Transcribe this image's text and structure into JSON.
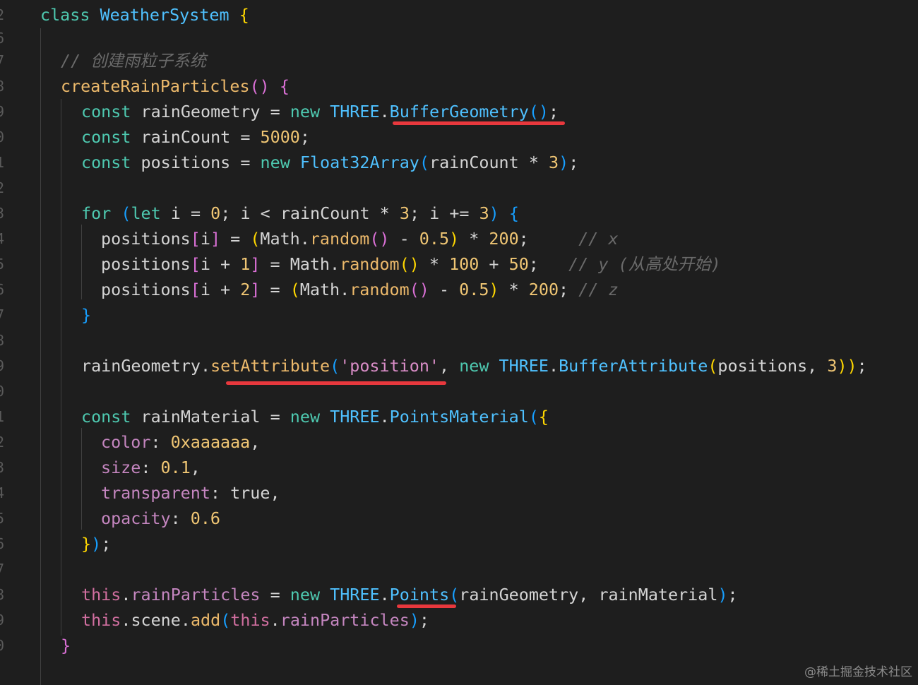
{
  "editor": {
    "line_numbers": [
      "2",
      "6",
      "7",
      "8",
      "9",
      "0",
      "1",
      "2",
      "3",
      "4",
      "5",
      "6",
      "7",
      "8",
      "9",
      "0",
      "1",
      "2",
      "3",
      "4",
      "5",
      "6",
      "7",
      "8",
      "9",
      "0"
    ],
    "code": {
      "l1": {
        "a": "class",
        "b": "WeatherSystem",
        "c": "{"
      },
      "l2": {
        "a": "// 创建雨粒子系统"
      },
      "l3": {
        "a": "createRainParticles",
        "b": "()",
        "c": "{"
      },
      "l4": {
        "a": "const",
        "b": "rainGeometry",
        "c": "=",
        "d": "new",
        "e": "THREE",
        "f": ".",
        "g": "BufferGeometry",
        "h": "()",
        "i": ";"
      },
      "l5": {
        "a": "const",
        "b": "rainCount",
        "c": "=",
        "d": "5000",
        "e": ";"
      },
      "l6": {
        "a": "const",
        "b": "positions",
        "c": "=",
        "d": "new",
        "e": "Float32Array",
        "f": "(",
        "g": "rainCount",
        "h": "*",
        "i": "3",
        "j": ")",
        "k": ";"
      },
      "l7": {
        "a": "for",
        "b": "(",
        "c": "let",
        "d": "i",
        "e": "=",
        "f": "0",
        "g": ";",
        "h": "i",
        "i": "<",
        "j": "rainCount",
        "k": "*",
        "l": "3",
        "m": ";",
        "n": "i",
        "o": "+=",
        "p": "3",
        "q": ")",
        "r": "{"
      },
      "l8": {
        "a": "positions",
        "b": "[",
        "c": "i",
        "d": "]",
        "e": "=",
        "f": "(",
        "g": "Math",
        "h": ".",
        "i": "random",
        "j": "()",
        "k": "-",
        "l": "0.5",
        "m": ")",
        "n": "*",
        "o": "200",
        "p": ";",
        "q": "// x"
      },
      "l9": {
        "a": "positions",
        "b": "[",
        "c": "i",
        "d": "+",
        "e": "1",
        "f": "]",
        "g": "=",
        "h": "Math",
        "i": ".",
        "j": "random",
        "k": "()",
        "l": "*",
        "m": "100",
        "n": "+",
        "o": "50",
        "p": ";",
        "q": "// y (从高处开始)"
      },
      "l10": {
        "a": "positions",
        "b": "[",
        "c": "i",
        "d": "+",
        "e": "2",
        "f": "]",
        "g": "=",
        "h": "(",
        "i": "Math",
        "j": ".",
        "k": "random",
        "l": "()",
        "m": "-",
        "n": "0.5",
        "o": ")",
        "p": "*",
        "q": "200",
        "r": ";",
        "s": "// z"
      },
      "l11": {
        "a": "}"
      },
      "l12": {
        "a": "rainGeometry",
        "b": ".",
        "c": "setAttribute",
        "d": "(",
        "e": "'position'",
        "f": ",",
        "g": "new",
        "h": "THREE",
        "i": ".",
        "j": "BufferAttribute",
        "k": "(",
        "l": "positions",
        "m": ",",
        "n": "3",
        "o": "))",
        "p": ";"
      },
      "l13": {
        "a": "const",
        "b": "rainMaterial",
        "c": "=",
        "d": "new",
        "e": "THREE",
        "f": ".",
        "g": "PointsMaterial",
        "h": "(",
        "i": "{"
      },
      "l14": {
        "a": "color",
        "b": ":",
        "c": "0xaaaaaa",
        "d": ","
      },
      "l15": {
        "a": "size",
        "b": ":",
        "c": "0.1",
        "d": ","
      },
      "l16": {
        "a": "transparent",
        "b": ":",
        "c": "true",
        "d": ","
      },
      "l17": {
        "a": "opacity",
        "b": ":",
        "c": "0.6"
      },
      "l18": {
        "a": "}",
        "b": ")",
        "c": ";"
      },
      "l19": {
        "a": "this",
        "b": ".",
        "c": "rainParticles",
        "d": "=",
        "e": "new",
        "f": "THREE",
        "g": ".",
        "h": "Points",
        "i": "(",
        "j": "rainGeometry",
        "k": ",",
        "l": "rainMaterial",
        "m": ")",
        "n": ";"
      },
      "l20": {
        "a": "this",
        "b": ".",
        "c": "scene",
        "d": ".",
        "e": "add",
        "f": "(",
        "g": "this",
        "h": ".",
        "i": "rainParticles",
        "j": ")",
        "k": ";"
      },
      "l21": {
        "a": "}"
      }
    }
  },
  "watermark": "@稀土掘金技术社区",
  "colors": {
    "background": "#1e1e1e",
    "highlight_underline": "#e8383d"
  }
}
